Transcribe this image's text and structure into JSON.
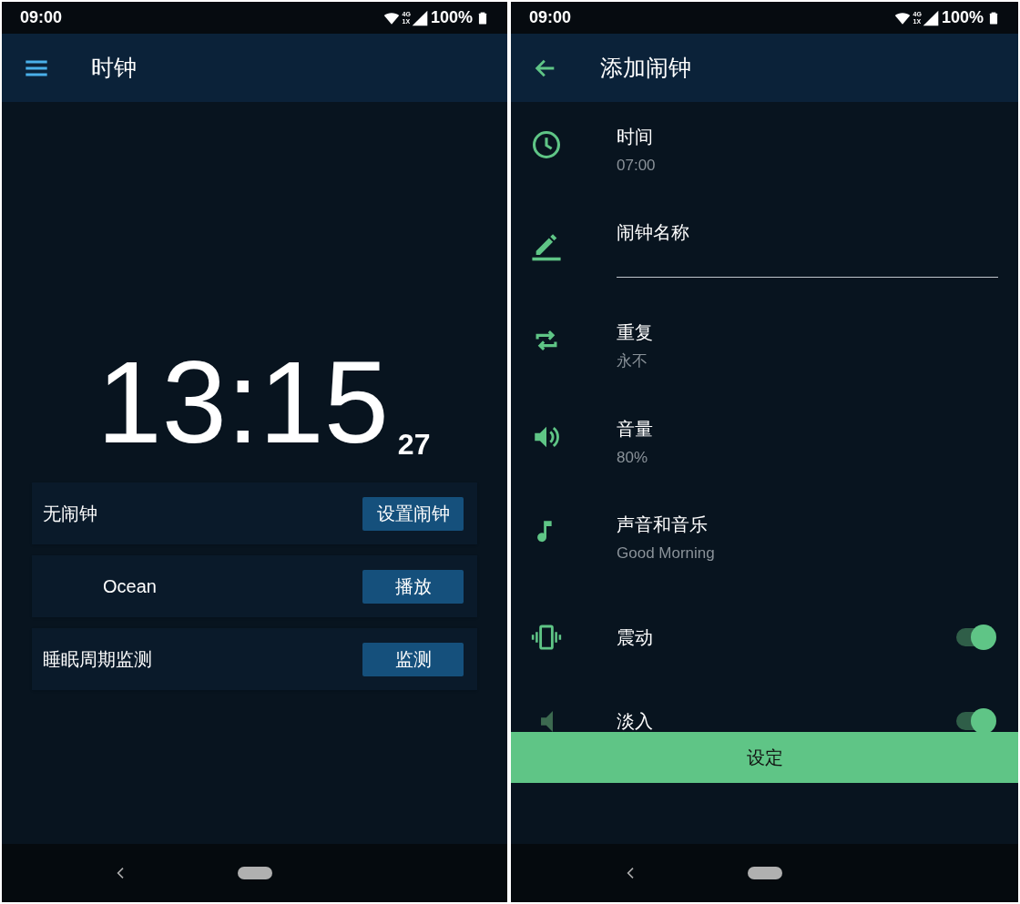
{
  "clock_screen": {
    "status_bar": {
      "time": "09:00",
      "network_top": "4G",
      "network_bottom": "1X",
      "battery": "100%"
    },
    "app_bar": {
      "title": "时钟"
    },
    "clock": {
      "time": "13:15",
      "seconds": "27"
    },
    "cards": [
      {
        "label": "无闹钟",
        "indented": false,
        "button": "设置闹钟"
      },
      {
        "label": "Ocean",
        "indented": true,
        "button": "播放"
      },
      {
        "label": "睡眠周期监测",
        "indented": false,
        "button": "监测"
      }
    ]
  },
  "add_alarm_screen": {
    "status_bar": {
      "time": "09:00",
      "network_top": "4G",
      "network_bottom": "1X",
      "battery": "100%"
    },
    "app_bar": {
      "title": "添加闹钟"
    },
    "settings": [
      {
        "kind": "value",
        "title": "时间",
        "value": "07:00"
      },
      {
        "kind": "input",
        "title": "闹钟名称"
      },
      {
        "kind": "value",
        "title": "重复",
        "value": "永不"
      },
      {
        "kind": "value",
        "title": "音量",
        "value": "80%"
      },
      {
        "kind": "value",
        "title": "声音和音乐",
        "value": "Good Morning"
      },
      {
        "kind": "toggle",
        "title": "震动",
        "on": true
      },
      {
        "kind": "toggle",
        "title": "淡入",
        "on": true
      }
    ],
    "set_button": "设定"
  }
}
